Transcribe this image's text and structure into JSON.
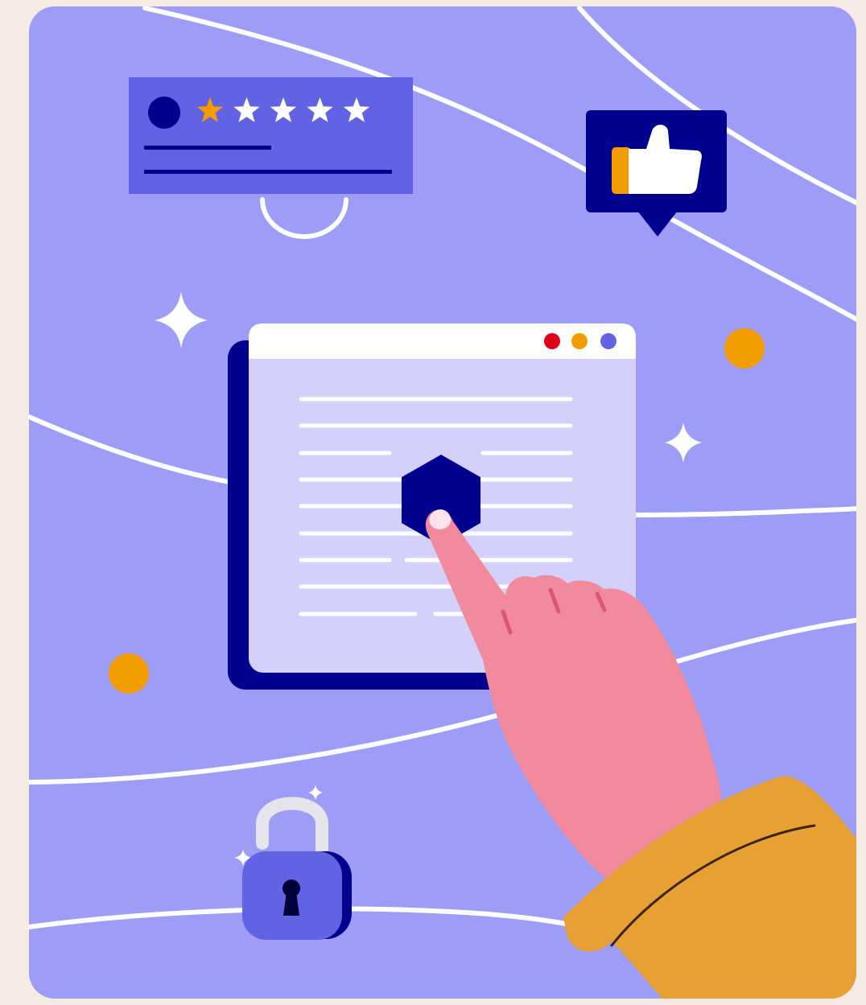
{
  "illustration": {
    "colors": {
      "page_bg": "#f5ebe4",
      "card_bg": "#9d9cf7",
      "wave": "#ffffff",
      "navy": "#00008f",
      "panel": "#6262e4",
      "window_body": "#d3d1fb",
      "window_bar": "#ffffff",
      "accent_orange": "#f29c00",
      "dot_red": "#e0001b",
      "dot_blue": "#6262e4",
      "skin": "#f28a9d",
      "skin_shadow": "#d9576f",
      "nail": "#fde4ea",
      "sleeve": "#e6a033",
      "sleeve_line": "#3a2400",
      "lock_body": "#6262e4",
      "lock_shackle": "#e4e4ea"
    },
    "rating": {
      "filled_stars": 1,
      "total_stars": 5
    },
    "icons": [
      "avatar-icon",
      "star-icon",
      "thumbs-up-icon",
      "sparkle-icon",
      "hexagon-button-icon",
      "pointing-hand-icon",
      "padlock-icon",
      "keyhole-icon"
    ]
  }
}
